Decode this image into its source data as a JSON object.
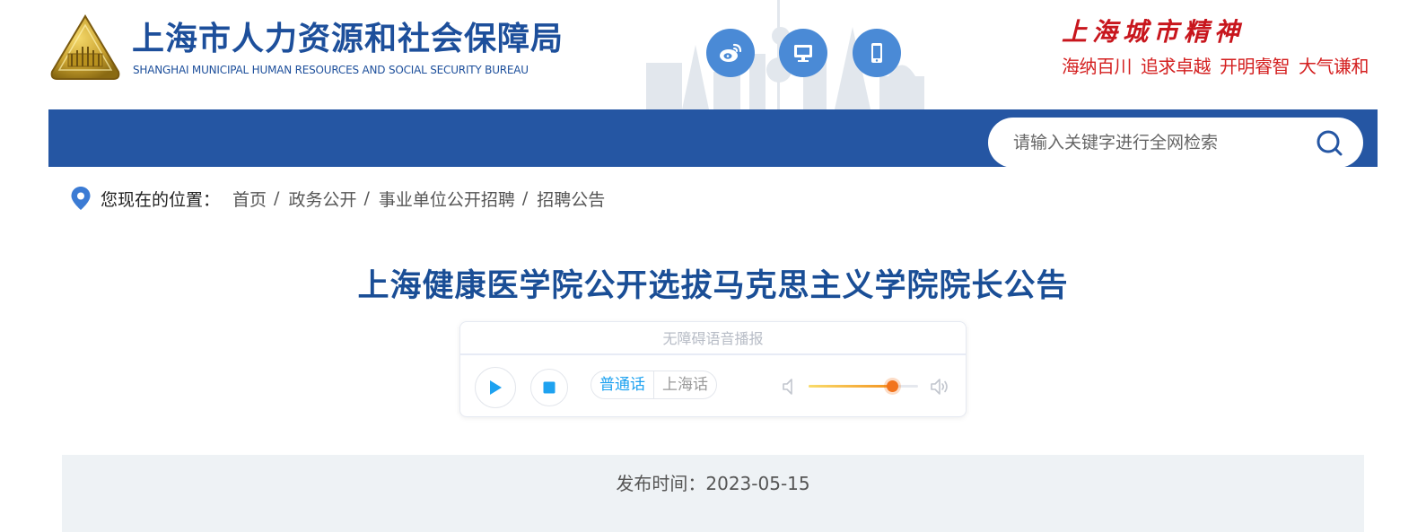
{
  "header": {
    "site_name_cn": "上海市人力资源和社会保障局",
    "site_name_en": "SHANGHAI MUNICIPAL HUMAN RESOURCES AND SOCIAL SECURITY BUREAU",
    "emblem_icon": "bureau-emblem-icon",
    "quick_links": [
      {
        "icon": "weibo-icon"
      },
      {
        "icon": "desktop-icon"
      },
      {
        "icon": "mobile-icon"
      }
    ],
    "city_spirit_title": "上海城市精神",
    "city_spirit_phrases": [
      "海纳百川",
      "追求卓越",
      "开明睿智",
      "大气谦和"
    ]
  },
  "navbar": {
    "background_color": "#2556a3",
    "search_placeholder": "请输入关键字进行全网检索",
    "search_icon": "search-icon"
  },
  "breadcrumb": {
    "lead": "您现在的位置：",
    "items": [
      "首页",
      "政务公开",
      "事业单位公开招聘",
      "招聘公告"
    ],
    "separator": "/"
  },
  "article": {
    "title": "上海健康医学院公开选拔马克思主义学院院长公告"
  },
  "player": {
    "title": "无障碍语音播报",
    "languages": [
      "普通话",
      "上海话"
    ],
    "selected_language": "普通话",
    "volume_fraction": 0.76,
    "accent_color": "#1ea2f0"
  },
  "publish": {
    "text": "发布时间：2023-05-15"
  }
}
